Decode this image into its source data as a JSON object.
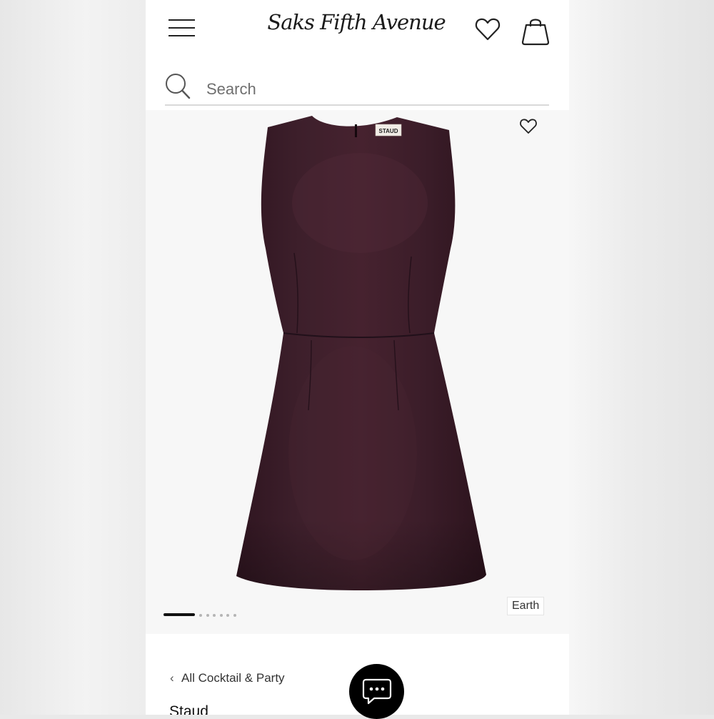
{
  "header": {
    "logo_text": "Saks Fifth Avenue",
    "menu_icon": "hamburger-menu-icon",
    "wishlist_icon": "heart-outline-icon",
    "bag_icon": "shopping-bag-icon"
  },
  "search": {
    "placeholder": "Search",
    "icon": "search-icon"
  },
  "product_image": {
    "label_text": "STAUD",
    "dress_color": "#3a1d28",
    "background_color": "#f7f7f7"
  },
  "gallery": {
    "favorite_icon": "heart-outline-icon",
    "total_images": 7,
    "active_image": 1,
    "color_label": "Earth"
  },
  "breadcrumb": {
    "label": "All Cocktail & Party",
    "icon": "chevron-left-icon"
  },
  "product": {
    "brand": "Staud"
  },
  "chat": {
    "icon": "chat-bubble-icon",
    "background": "#000000"
  }
}
